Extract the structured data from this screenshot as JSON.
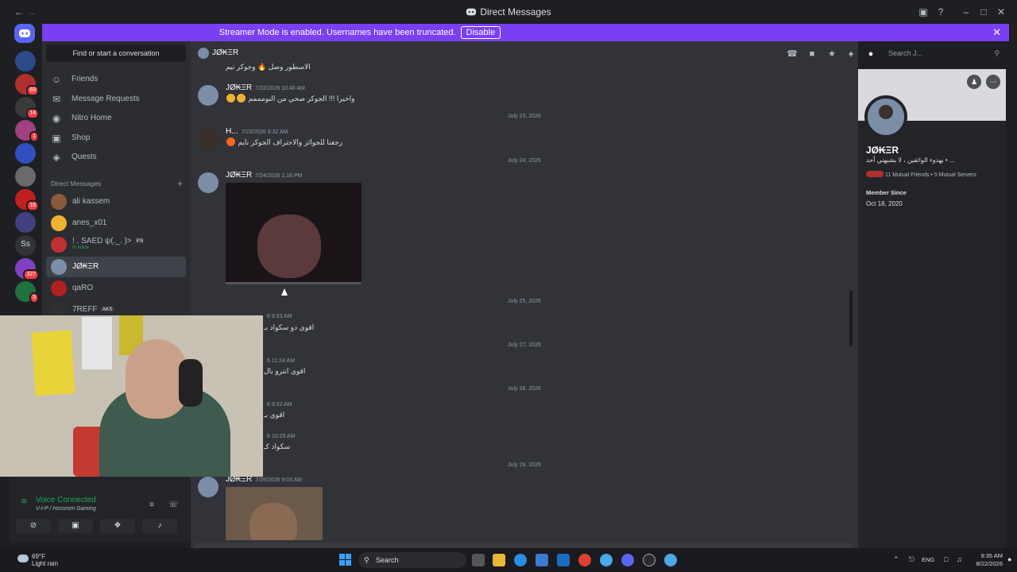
{
  "window": {
    "title": "Direct Messages"
  },
  "banner": {
    "text": "Streamer Mode is enabled. Usernames have been truncated.",
    "disable_label": "Disable"
  },
  "guilds": [
    {
      "color": "#2b4a8a",
      "badge": ""
    },
    {
      "color": "#b03030",
      "badge": "69"
    },
    {
      "color": "#3a3a3a",
      "badge": "14"
    },
    {
      "color": "#a04080",
      "badge": "1"
    },
    {
      "color": "#3050c0",
      "badge": ""
    },
    {
      "color": "#6a6a6a",
      "badge": ""
    },
    {
      "color": "#c02020",
      "badge": "16"
    },
    {
      "color": "#404080",
      "badge": ""
    },
    {
      "color": "#313338",
      "badge": "",
      "text": "Ss"
    },
    {
      "color": "#8040c0",
      "badge": "327"
    },
    {
      "color": "#207040",
      "badge": "5"
    }
  ],
  "sidebar": {
    "find_conversation": "Find or start a conversation",
    "nav": [
      {
        "label": "Friends",
        "icon": "friends-icon"
      },
      {
        "label": "Message Requests",
        "icon": "mail-icon"
      },
      {
        "label": "Nitro Home",
        "icon": "nitro-icon"
      },
      {
        "label": "Shop",
        "icon": "shop-icon"
      },
      {
        "label": "Quests",
        "icon": "quests-icon"
      }
    ],
    "dm_header": "Direct Messages",
    "dms": [
      {
        "name": "ali kassem",
        "sub": "",
        "tag": "",
        "color": "#8a5a3a"
      },
      {
        "name": "anes_x01",
        "sub": "",
        "tag": "",
        "color": "#f0b232"
      },
      {
        "name": "! . SAED ψ(._. )>",
        "sub": "In voice",
        "tag": "PS",
        "color": "#c03030"
      },
      {
        "name": "JØ₭ΞR",
        "sub": "",
        "tag": "",
        "color": "#7a8ea8",
        "active": true
      },
      {
        "name": "qaRO",
        "sub": "",
        "tag": "",
        "color": "#b02020"
      },
      {
        "name": "7REFF",
        "sub": "",
        "tag": "AKS",
        "color": "#303030"
      }
    ]
  },
  "chat": {
    "recipient": "JØ₭ΞR",
    "search_placeholder": "Search J...",
    "top_snippet": "الاسطور وصل 🔥 وجوكر نيم",
    "messages": [
      {
        "author": "JØ₭ΞR",
        "time": "7/22/2026 10:46 AM",
        "text": "واخيرا !!! الجوكر صحي من النومممم"
      },
      {
        "author": "H...",
        "time": "7/23/2026 9:32 AM",
        "text": "رجعنا للجوائز والاحتراف الجوكر نايم"
      },
      {
        "author": "JØ₭ΞR",
        "time": "7/24/2026 1:16 PM",
        "text": ""
      },
      {
        "author": "JØ₭ΞR",
        "time": "7/29/2026 9:03 AM",
        "text": ""
      }
    ],
    "partial_messages": [
      {
        "time": "6 9:33 AM",
        "text": "اقوى دو سكواد بـ"
      },
      {
        "time": "6 11:24 AM",
        "text": "اقوى انترو بال"
      },
      {
        "time": "6 9:32 AM",
        "text": "اقوى بـ"
      },
      {
        "time": "6 10:25 AM",
        "text": "سكواد كـ"
      }
    ],
    "dates": [
      "July 23, 2026",
      "July 24, 2026",
      "July 25, 2026",
      "July 27, 2026",
      "July 28, 2026",
      "July 29, 2026"
    ]
  },
  "profile": {
    "name": "JØ₭ΞR",
    "bio": "بهدوء الواثقين ، لا يشبهني أحد • ...",
    "mutual_friends": "11 Mutual Friends",
    "mutual_servers": "5 Mutual Servers",
    "member_since_label": "Member Since",
    "member_since": "Oct 18, 2020"
  },
  "voice": {
    "status": "Voice Connected",
    "channel": "V-I-P / Hossrom Gaming"
  },
  "taskbar": {
    "weather_temp": "69°F",
    "weather_cond": "Light rain",
    "search_label": "Search",
    "lang": "ENG",
    "time": "9:35 AM",
    "date": "8/22/2026"
  },
  "colors": {
    "accent": "#5865f2",
    "banner": "#7a3ef3",
    "online": "#23a55a"
  }
}
